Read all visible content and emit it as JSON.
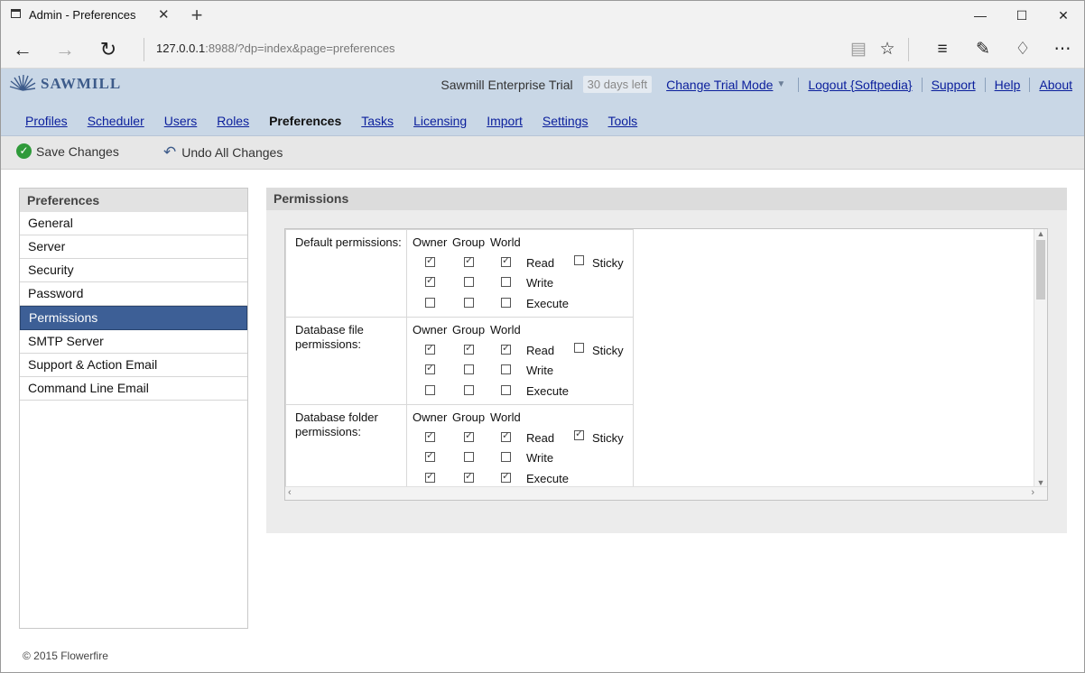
{
  "browser": {
    "tab_title": "Admin - Preferences",
    "new_tab": "+",
    "url_host": "127.0.0.1",
    "url_rest": ":8988/?dp=index&page=preferences"
  },
  "header": {
    "logo_text": "SAWMILL",
    "product": "Sawmill Enterprise Trial",
    "days_left": "30 days left",
    "change_trial": "Change Trial Mode",
    "logout": "Logout {Softpedia}",
    "support": "Support",
    "help": "Help",
    "about": "About"
  },
  "nav": [
    "Profiles",
    "Scheduler",
    "Users",
    "Roles",
    "Preferences",
    "Tasks",
    "Licensing",
    "Import",
    "Settings",
    "Tools"
  ],
  "toolbar": {
    "save": "Save Changes",
    "undo": "Undo All Changes"
  },
  "sidebar": {
    "title": "Preferences",
    "items": [
      "General",
      "Server",
      "Security",
      "Password",
      "Permissions",
      "SMTP Server",
      "Support & Action Email",
      "Command Line Email"
    ],
    "active": "Permissions"
  },
  "panel": {
    "title": "Permissions",
    "columns": [
      "Owner",
      "Group",
      "World"
    ],
    "rows_labels": [
      "Read",
      "Write",
      "Execute"
    ],
    "sticky_label": "Sticky",
    "groups": [
      {
        "label": "Default permissions:",
        "read": [
          true,
          true,
          true
        ],
        "write": [
          true,
          false,
          false
        ],
        "execute": [
          false,
          false,
          false
        ],
        "sticky": false
      },
      {
        "label": "Database file permissions:",
        "read": [
          true,
          true,
          true
        ],
        "write": [
          true,
          false,
          false
        ],
        "execute": [
          false,
          false,
          false
        ],
        "sticky": false
      },
      {
        "label": "Database folder permissions:",
        "read": [
          true,
          true,
          true
        ],
        "write": [
          true,
          false,
          false
        ],
        "execute": [
          true,
          true,
          true
        ],
        "sticky": true
      }
    ]
  },
  "footer": "© 2015 Flowerfire"
}
